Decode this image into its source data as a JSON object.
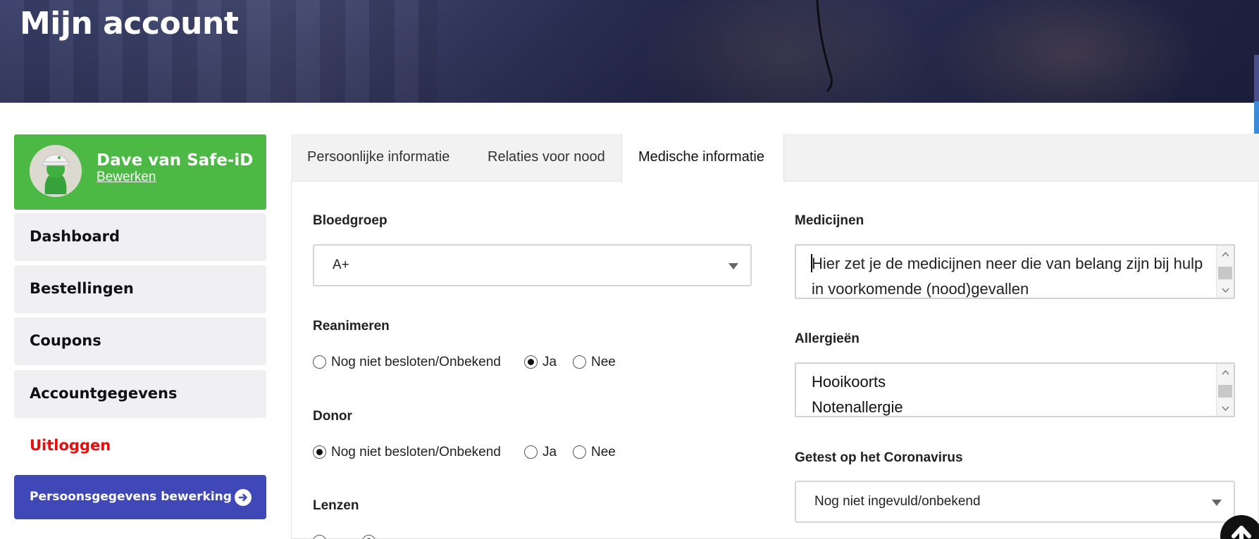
{
  "page": {
    "title": "Mijn account"
  },
  "profile": {
    "name": "Dave van Safe-iD",
    "edit_label": "Bewerken"
  },
  "sidebar": {
    "items": [
      {
        "label": "Dashboard"
      },
      {
        "label": "Bestellingen"
      },
      {
        "label": "Coupons"
      },
      {
        "label": "Accountgegevens"
      }
    ],
    "logout_label": "Uitloggen",
    "gdpr_button_label": "Persoonsgegevens bewerking"
  },
  "tabs": [
    {
      "label": "Persoonlijke informatie",
      "active": false
    },
    {
      "label": "Relaties voor nood",
      "active": false
    },
    {
      "label": "Medische informatie",
      "active": true
    }
  ],
  "form": {
    "blood_group": {
      "label": "Bloedgroep",
      "value": "A+"
    },
    "resuscitate": {
      "label": "Reanimeren",
      "options": [
        "Nog niet besloten/Onbekend",
        "Ja",
        "Nee"
      ],
      "selected": "Ja"
    },
    "donor": {
      "label": "Donor",
      "options": [
        "Nog niet besloten/Onbekend",
        "Ja",
        "Nee"
      ],
      "selected": "Nog niet besloten/Onbekend"
    },
    "lenses": {
      "label": "Lenzen"
    },
    "medicines": {
      "label": "Medicijnen",
      "placeholder": "Hier zet je de medicijnen neer die van belang zijn bij hulp in voorkomende (nood)gevallen"
    },
    "allergies": {
      "label": "Allergieën",
      "lines": [
        "Hooikoorts",
        "Notenallergie"
      ]
    },
    "corona": {
      "label": "Getest op het Coronavirus",
      "value": "Nog niet ingevuld/onbekend"
    }
  },
  "colors": {
    "profile_green": "#4cb944",
    "gdpr_blue": "#4048b8",
    "logout_red": "#e60d0d",
    "nav_bg": "#f0f0f2"
  },
  "icons": {
    "gdpr_button_icon": "arrow-circle-right-icon",
    "scroll_top_icon": "arrow-up-icon"
  }
}
